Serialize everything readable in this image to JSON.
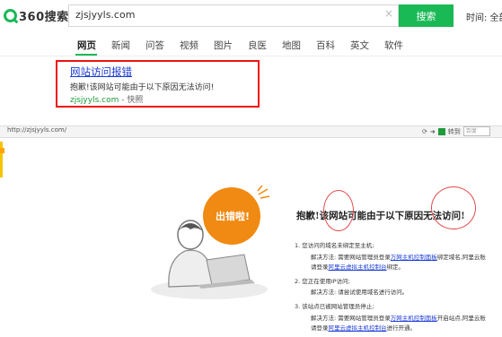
{
  "header": {
    "logo_text": "360搜索",
    "query": "zjsjyyls.com",
    "search_button": "搜索",
    "time_label": "时间: 全部"
  },
  "nav": {
    "tabs": [
      "网页",
      "新闻",
      "问答",
      "视频",
      "图片",
      "良医",
      "地图",
      "百科",
      "英文",
      "软件"
    ],
    "active": "网页"
  },
  "result": {
    "title": "网站访问报错",
    "desc": "抱歉!该网站可能由于以下原因无法访问!",
    "url": "zjsjyyls.com",
    "sep": " - ",
    "snapshot": "快照"
  },
  "browser": {
    "address": "http://zjsjyyls.com/",
    "search_placeholder": "百度"
  },
  "error": {
    "bubble": "出错啦!",
    "heading": "抱歉!该网站可能由于以下原因无法访问!",
    "r1_title": "1. 您访问的域名未绑定至主机;",
    "r1_l1_a": "解决方法: 需要网站管理员登录",
    "r1_l1_link": "万网主机控制面板",
    "r1_l1_b": "绑定域名,阿里云账",
    "r1_l2_a": "请登录",
    "r1_l2_link": "阿里云虚拟主机控制台",
    "r1_l2_b": "绑定。",
    "r2_title": "2. 您正在使用IP访问;",
    "r2_l1": "解决方法: 请尝试使用域名进行访问。",
    "r3_title": "3. 该站点已被网站管理员停止;",
    "r3_l1_a": "解决方法: 需要网站管理员登录",
    "r3_l1_link": "万网主机控制面板",
    "r3_l1_b": "开启站点,阿里云账",
    "r3_l2_a": "请登录",
    "r3_l2_link": "阿里云虚拟主机控制台",
    "r3_l2_b": "进行开通。"
  },
  "colors": {
    "brand_green": "#19b955",
    "highlight_red": "#e11111",
    "bubble_orange": "#f08a12"
  }
}
